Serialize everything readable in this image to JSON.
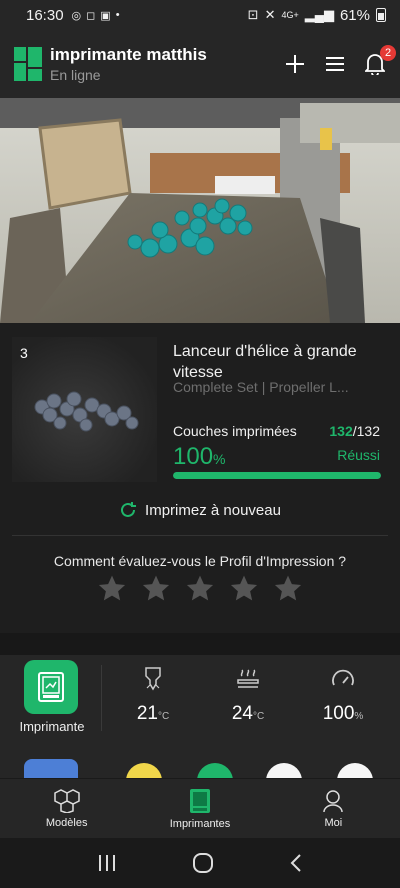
{
  "status_bar": {
    "time": "16:30",
    "battery": "61%",
    "network": "4G+"
  },
  "header": {
    "title": "imprimante matthis",
    "subtitle": "En ligne",
    "notification_count": "2"
  },
  "job": {
    "plate_number": "3",
    "title": "Lanceur d'hélice à grande vitesse",
    "subtitle": "Complete Set | Propeller L...",
    "layers_label": "Couches imprimées",
    "layers_current": "132",
    "layers_total": "/132",
    "percent": "100",
    "percent_unit": "%",
    "progress": 1.0,
    "status": "Réussi"
  },
  "reprint_label": "Imprimez à nouveau",
  "rating": {
    "question": "Comment évaluez-vous le Profil d'Impression ?",
    "stars": 5
  },
  "device": {
    "label": "Imprimante",
    "stats": [
      {
        "value": "21",
        "unit": "°C"
      },
      {
        "value": "24",
        "unit": "°C"
      },
      {
        "value": "100",
        "unit": "%"
      }
    ]
  },
  "tabs": [
    {
      "label": "Modèles"
    },
    {
      "label": "Imprimantes"
    },
    {
      "label": "Moi"
    }
  ],
  "colors": {
    "accent": "#1fb66b",
    "badge": "#e53935",
    "background": "#1e1e1e"
  }
}
